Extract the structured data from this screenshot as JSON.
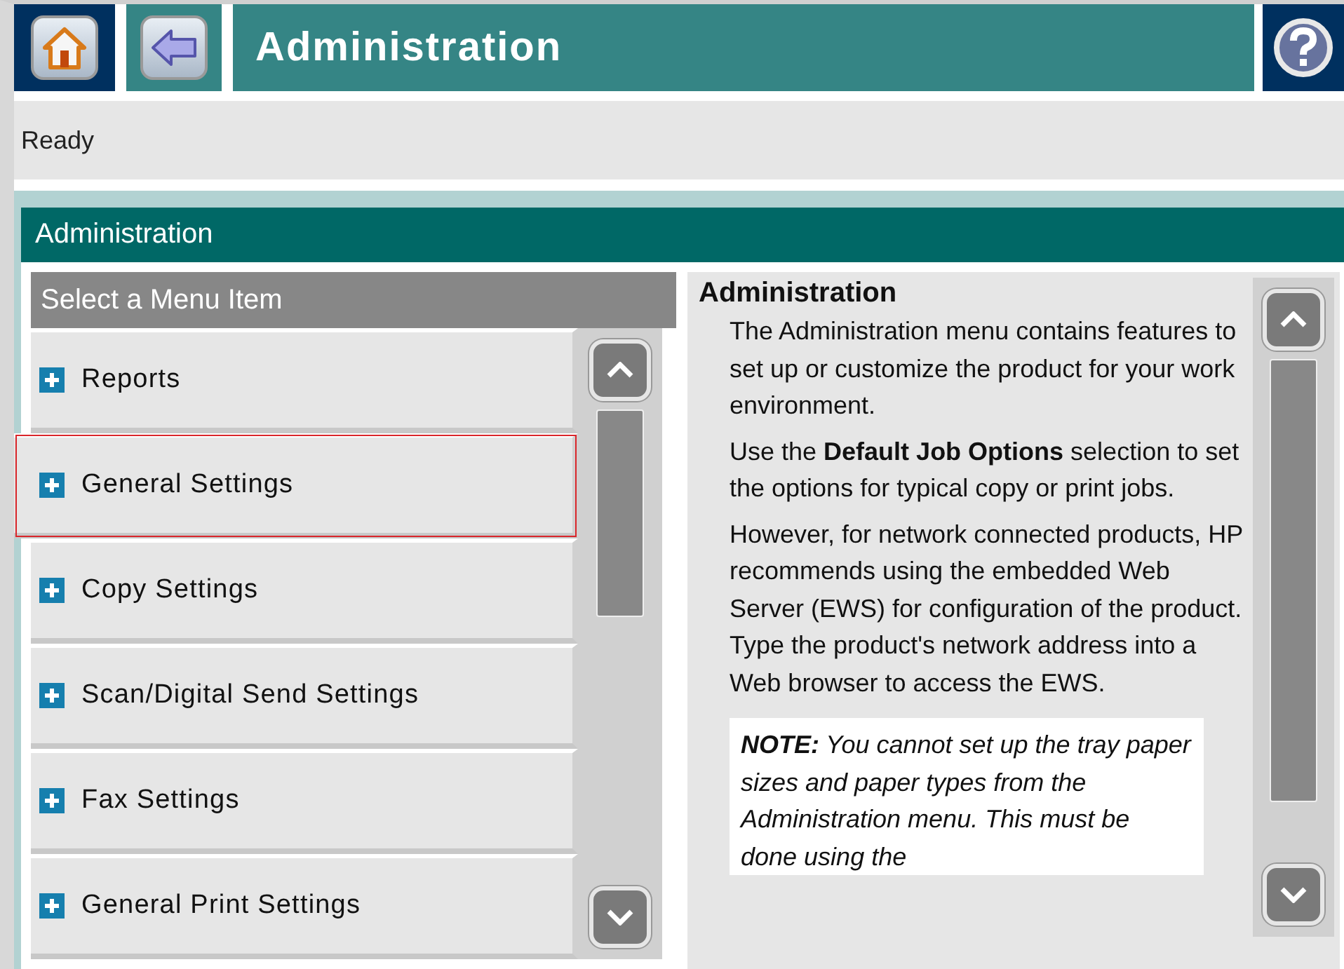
{
  "top_bar": {
    "title": "Administration"
  },
  "status": "Ready",
  "section_title": "Administration",
  "menu": {
    "heading": "Select a Menu Item",
    "items": [
      {
        "label": "Reports",
        "selected": false
      },
      {
        "label": "General Settings",
        "selected": true
      },
      {
        "label": "Copy Settings",
        "selected": false
      },
      {
        "label": "Scan/Digital Send Settings",
        "selected": false
      },
      {
        "label": "Fax Settings",
        "selected": false
      },
      {
        "label": "General Print Settings",
        "selected": false
      }
    ]
  },
  "help": {
    "title": "Administration",
    "paragraphs": [
      "The Administration menu contains features to set up or customize the product for your work environment.",
      "Use the **Default Job Options** selection to set the options for typical copy or print jobs.",
      "However, for network connected products, HP recommends using the embedded Web Server (EWS) for configuration of the product. Type the product's network address into a Web browser to access the EWS."
    ],
    "note": "**NOTE:** You cannot set up the tray paper sizes and paper types from the Administration menu. This must be done using the"
  }
}
